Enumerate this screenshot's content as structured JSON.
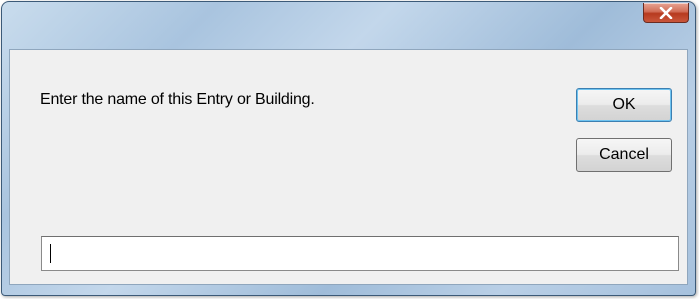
{
  "window": {
    "close_label": "x",
    "close_icon": "close-icon",
    "prompt": "Enter the name of this Entry or Building.",
    "ok_label": "OK",
    "cancel_label": "Cancel",
    "input_value": "",
    "input_placeholder": ""
  },
  "colors": {
    "close_button": "#c9563b",
    "client_background": "#f0f0f0",
    "default_button_border": "#3c7fb1"
  }
}
